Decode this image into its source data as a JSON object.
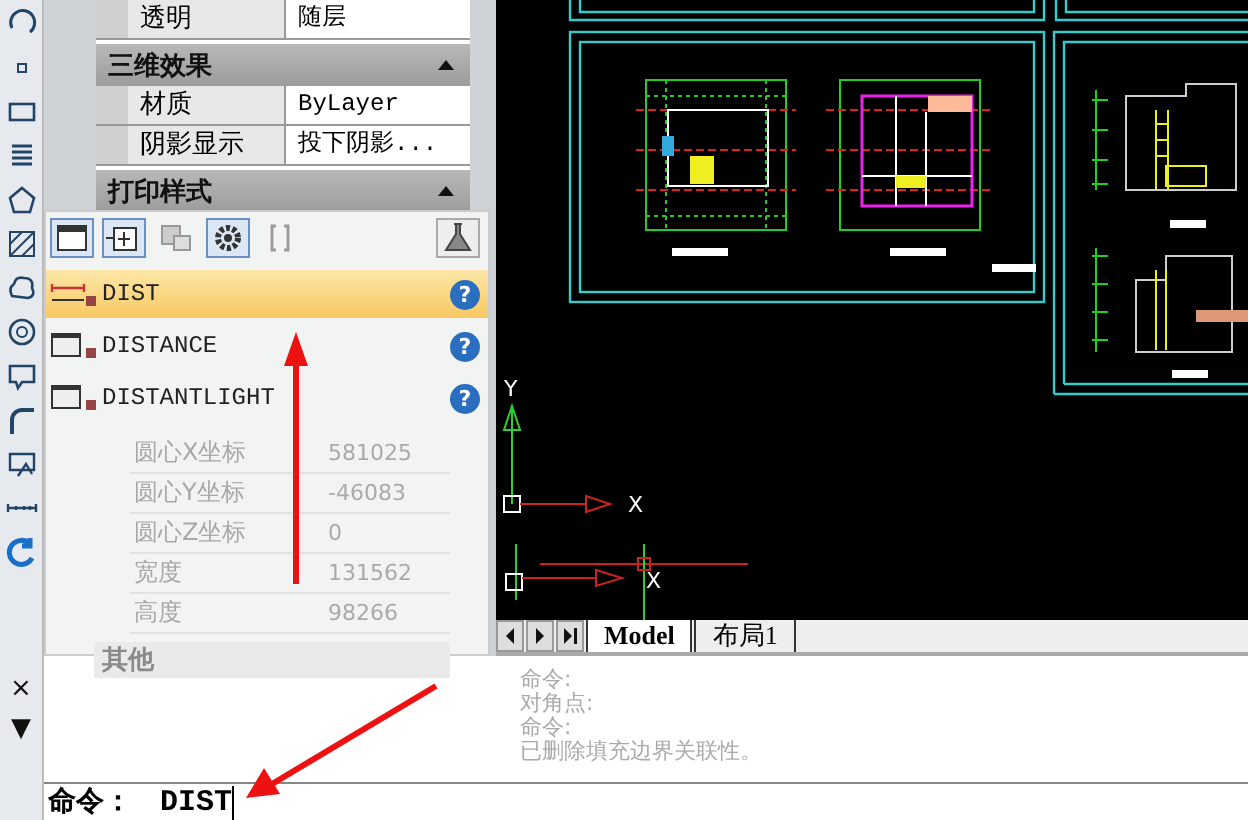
{
  "properties": {
    "rows": [
      {
        "kind": "row",
        "label": "透明",
        "value": "随层"
      },
      {
        "kind": "section",
        "label": "三维效果",
        "expanded": true
      },
      {
        "kind": "row",
        "label": "材质",
        "value": "ByLayer"
      },
      {
        "kind": "row",
        "label": "阴影显示",
        "value": "投下阴影..."
      },
      {
        "kind": "section",
        "label": "打印样式",
        "expanded": true
      }
    ]
  },
  "autocomplete": {
    "items": [
      {
        "kind": "measure",
        "name": "DIST",
        "selected": true,
        "help": "?"
      },
      {
        "kind": "window",
        "name": "DISTANCE",
        "selected": false,
        "help": "?"
      },
      {
        "kind": "window",
        "name": "DISTANTLIGHT",
        "selected": false,
        "help": "?"
      }
    ],
    "faded_rows": [
      {
        "label": "圆心X坐标",
        "value": "581025"
      },
      {
        "label": "圆心Y坐标",
        "value": "-46083"
      },
      {
        "label": "圆心Z坐标",
        "value": "0"
      },
      {
        "label": "宽度",
        "value": "131562"
      },
      {
        "label": "高度",
        "value": "98266"
      }
    ],
    "faded_section": "其他"
  },
  "canvas": {
    "ucs_labels": [
      {
        "y": "Y",
        "x": "X"
      },
      {
        "x": "X"
      }
    ]
  },
  "layout_tabs": [
    {
      "label": "Model",
      "selected": true
    },
    {
      "label": "布局1",
      "selected": false
    }
  ],
  "command": {
    "side_buttons": [
      "×",
      "▼"
    ],
    "history": [
      "命令:",
      "对角点:",
      "命令:",
      "已删除填充边界关联性。"
    ],
    "prompt": "命令：",
    "input": "DIST"
  }
}
